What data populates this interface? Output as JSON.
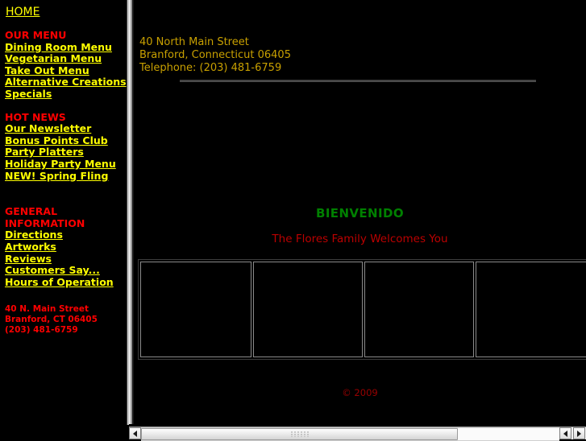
{
  "sidebar": {
    "home_label": "HOME",
    "groups": [
      {
        "heading": "OUR MENU",
        "items": [
          "Dining Room Menu",
          "Vegetarian Menu",
          "Take Out Menu",
          "Alternative Creations",
          "Specials"
        ]
      },
      {
        "heading": "HOT NEWS",
        "items": [
          "Our Newsletter",
          "Bonus Points Club",
          "Party Platters",
          "Holiday Party Menu",
          "NEW! Spring Fling"
        ]
      },
      {
        "heading_line1": "GENERAL",
        "heading_line2": "INFORMATION",
        "items": [
          "Directions",
          "Artworks",
          "Reviews",
          "Customers Say...",
          "Hours of Operation"
        ]
      }
    ],
    "address": {
      "line1": "40 N. Main Street",
      "line2": "Branford, CT 06405",
      "line3": "(203) 481-6759"
    }
  },
  "main": {
    "header_address": {
      "line1": "40 North Main Street",
      "line2": "Branford, Connecticut 06405",
      "line3": "Telephone: (203) 481-6759"
    },
    "welcome_title": "BIENVENIDO",
    "welcome_subtitle": "The Flores Family Welcomes You",
    "gallery_cells": [
      "",
      "",
      "",
      ""
    ],
    "copyright": "© 2009"
  },
  "scrollbar": {
    "left_arrow": "◀",
    "right_arrow": "▶"
  },
  "colors": {
    "background": "#000000",
    "link": "#ffff00",
    "heading": "#ff0000",
    "address_gold": "#c8a000",
    "welcome_green": "#008000",
    "welcome_red": "#bb0000",
    "copyright_red": "#990000"
  }
}
